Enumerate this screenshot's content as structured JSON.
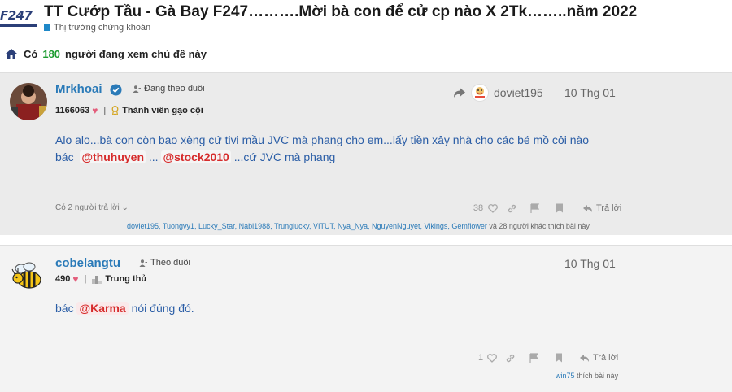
{
  "header": {
    "logo_text": "F247",
    "title": "TT Cướp Tầu - Gà Bay F247……….Mời bà con để cử cp nào X 2Tk……..năm 2022",
    "category": "Thị trường chứng khoán"
  },
  "watching": {
    "prefix": "Có",
    "count": "180",
    "suffix": "người đang xem chủ đề này"
  },
  "posts": [
    {
      "username": "Mrkhoai",
      "follow_label": "Đang theo đuôi",
      "points": "1166063",
      "rank": "Thành viên gạo cội",
      "shared_from": "doviet195",
      "date": "10 Thg 01",
      "body_line1": "Alo alo...bà con còn bao xèng cứ tivi mầu JVC mà phang cho em...lấy tiền xây nhà cho các bé mồ côi nào",
      "body_line2_prefix": "bác",
      "mention1": "@thuhuyen",
      "mid": "...",
      "mention2": "@stock2010",
      "body_line2_suffix": "...cứ JVC mà phang",
      "replies_label": "Có 2 người trả lời",
      "like_count": "38",
      "reply_label": "Trả lời",
      "likers": "doviet195, Tuongvy1, Lucky_Star, Nabi1988, Trunglucky, VITUT, Nya_Nya, NguyenNguyet, Vikings, Gemflower",
      "likers_suffix": "và 28 người khác thích bài này"
    },
    {
      "username": "cobelangtu",
      "follow_label": "Theo đuôi",
      "points": "490",
      "rank": "Trung thủ",
      "date": "10 Thg 01",
      "body_prefix": "bác",
      "mention": "@Karma",
      "body_suffix": "nói đúng đó.",
      "like_count": "1",
      "reply_label": "Trả lời",
      "likers": "win75",
      "likers_suffix": "thích bài này"
    }
  ],
  "colors": {
    "link": "#2a7ab8",
    "mention": "#d62c2c",
    "watch_count": "#1a9b2e",
    "heart": "#e35d7b"
  }
}
